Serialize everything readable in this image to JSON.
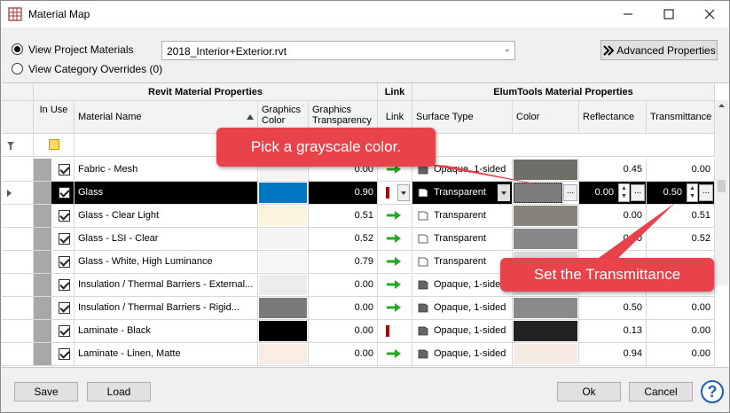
{
  "window": {
    "title": "Material Map"
  },
  "view_options": {
    "project_materials_label": "View Project Materials",
    "category_overrides_label": "View Category Overrides (0)",
    "selected": "project"
  },
  "project_file": {
    "value": "2018_Interior+Exterior.rvt"
  },
  "advanced_button": {
    "label": "Advanced Properties"
  },
  "grid": {
    "group_headers": {
      "revit": "Revit Material Properties",
      "link": "Link",
      "elum": "ElumTools Material Properties"
    },
    "columns": {
      "in_use": "In Use",
      "material_name": "Material Name",
      "graphics_color": "Graphics Color",
      "graphics_transparency": "Graphics Transparency",
      "link": "Link",
      "surface_type": "Surface Type",
      "color": "Color",
      "reflectance": "Reflectance",
      "transmittance": "Transmittance"
    },
    "rows": [
      {
        "name": "Fabric - Mesh",
        "gcolor": "#f4f4f4",
        "transparency": "0.00",
        "link": "arrow",
        "surface": "Opaque, 1-sided",
        "surface_icon": "opaque",
        "color": "#6f6f6a",
        "reflectance": "0.45",
        "transmittance": "0.00"
      },
      {
        "name": "Glass",
        "gcolor": "#0077c0",
        "transparency": "0.90",
        "link": "red",
        "surface": "Transparent",
        "surface_icon": "transparent",
        "color": "#7c7c7c",
        "reflectance": "0.00",
        "transmittance": "0.50",
        "selected": true
      },
      {
        "name": "Glass - Clear Light",
        "gcolor": "#fbf3de",
        "transparency": "0.51",
        "link": "arrow",
        "surface": "Transparent",
        "surface_icon": "transparent",
        "color": "#86847a",
        "reflectance": "0.00",
        "transmittance": "0.51"
      },
      {
        "name": "Glass - LSI - Clear",
        "gcolor": "#f4f4f4",
        "transparency": "0.52",
        "link": "arrow",
        "surface": "Transparent",
        "surface_icon": "transparent",
        "color": "#888888",
        "reflectance": "0.00",
        "transmittance": "0.52"
      },
      {
        "name": "Glass - White, High Luminance",
        "gcolor": "#f6f6f6",
        "transparency": "0.79",
        "link": "arrow",
        "surface": "Transparent",
        "surface_icon": "transparent",
        "color": "#d8d8d8",
        "reflectance": "",
        "transmittance": ""
      },
      {
        "name": "Insulation / Thermal Barriers - External...",
        "gcolor": "#ececec",
        "transparency": "0.00",
        "link": "arrow",
        "surface": "Opaque, 1-sided",
        "surface_icon": "opaque",
        "color": "#e4e4e4",
        "reflectance": "",
        "transmittance": ""
      },
      {
        "name": "Insulation / Thermal Barriers - Rigid...",
        "gcolor": "#7a7a7a",
        "transparency": "0.00",
        "link": "arrow",
        "surface": "Opaque, 1-sided",
        "surface_icon": "opaque",
        "color": "#8a8a8a",
        "reflectance": "0.50",
        "transmittance": "0.00"
      },
      {
        "name": "Laminate - Black",
        "gcolor": "#000000",
        "transparency": "0.00",
        "link": "red",
        "surface": "Opaque, 1-sided",
        "surface_icon": "opaque",
        "color": "#222222",
        "reflectance": "0.13",
        "transmittance": "0.00"
      },
      {
        "name": "Laminate - Linen, Matte",
        "gcolor": "#f9ece3",
        "transparency": "0.00",
        "link": "arrow",
        "surface": "Opaque, 1-sided",
        "surface_icon": "opaque",
        "color": "#f7ece4",
        "reflectance": "0.94",
        "transmittance": "0.00"
      }
    ]
  },
  "callouts": {
    "grayscale": "Pick a grayscale color.",
    "transmittance": "Set the Transmittance"
  },
  "footer": {
    "save": "Save",
    "load": "Load",
    "ok": "Ok",
    "cancel": "Cancel",
    "help": "?"
  },
  "colors": {
    "accent_red": "#e8434a",
    "link_arrow_green": "#22aa22",
    "link_red": "#b00000",
    "selected_row": "#000000"
  }
}
